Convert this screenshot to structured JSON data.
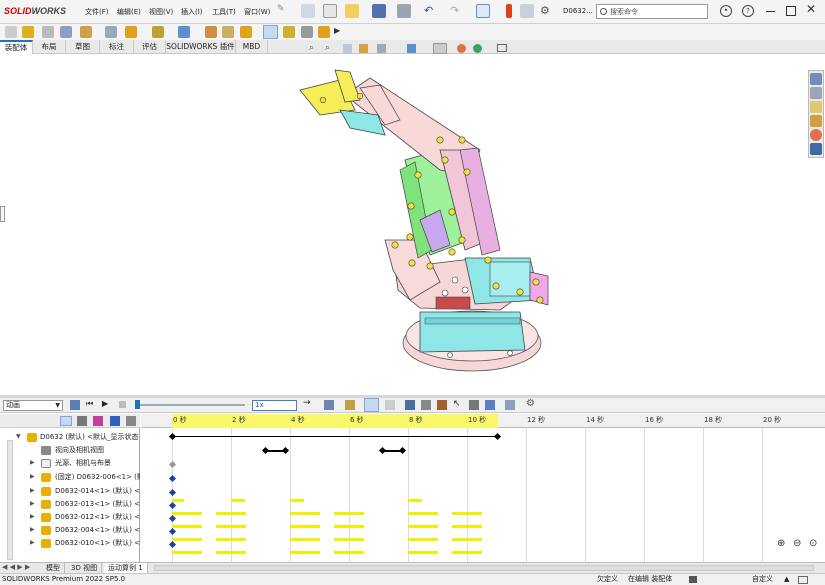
{
  "app": {
    "brand_a": "SOLID",
    "brand_b": "WORKS",
    "doc_name": "D0632...",
    "search_placeholder": "搜索命令"
  },
  "menu": [
    "文件(F)",
    "编辑(E)",
    "视图(V)",
    "插入(I)",
    "工具(T)",
    "窗口(W)"
  ],
  "command_tabs": [
    "装配体",
    "布局",
    "草图",
    "标注",
    "评估",
    "SOLIDWORKS 插件",
    "MBD"
  ],
  "active_tab": "装配体",
  "motion": {
    "study_type": "动画",
    "playback_speed": "1x",
    "time_ticks": [
      "0 秒",
      "2 秒",
      "4 秒",
      "6 秒",
      "8 秒",
      "10 秒",
      "12 秒",
      "14 秒",
      "16 秒",
      "18 秒",
      "20 秒"
    ],
    "tree": [
      {
        "label": "D0632 (默认) <默认_显示状态",
        "icon": "assembly-icon"
      },
      {
        "label": "视向及相机视图",
        "icon": "camera-icon"
      },
      {
        "label": "光源、相机与布景",
        "icon": "folder-icon"
      },
      {
        "label": "(固定) D0632-006<1> (默",
        "icon": "part-icon"
      },
      {
        "label": "D0632-014<1> (默认) <",
        "icon": "part-icon"
      },
      {
        "label": "D0632-013<1> (默认) <",
        "icon": "part-icon"
      },
      {
        "label": "D0632-012<1> (默认) <",
        "icon": "part-icon"
      },
      {
        "label": "D0632-004<1> (默认) <",
        "icon": "part-icon"
      },
      {
        "label": "D0632-010<1> (默认) <",
        "icon": "part-icon"
      }
    ]
  },
  "bottom_tabs": [
    "模型",
    "3D 视图",
    "运动算例 1"
  ],
  "active_bottom_tab": "运动算例 1",
  "status": {
    "product": "SOLIDWORKS Premium 2022 SP5.0",
    "s1": "欠定义",
    "s2": "在编辑 装配体",
    "s3": "自定义"
  },
  "colors": {
    "accent": "#1e73be",
    "brand": "#d10000",
    "timeline_bar": "#f0f000",
    "key_point": "#2040a0"
  }
}
